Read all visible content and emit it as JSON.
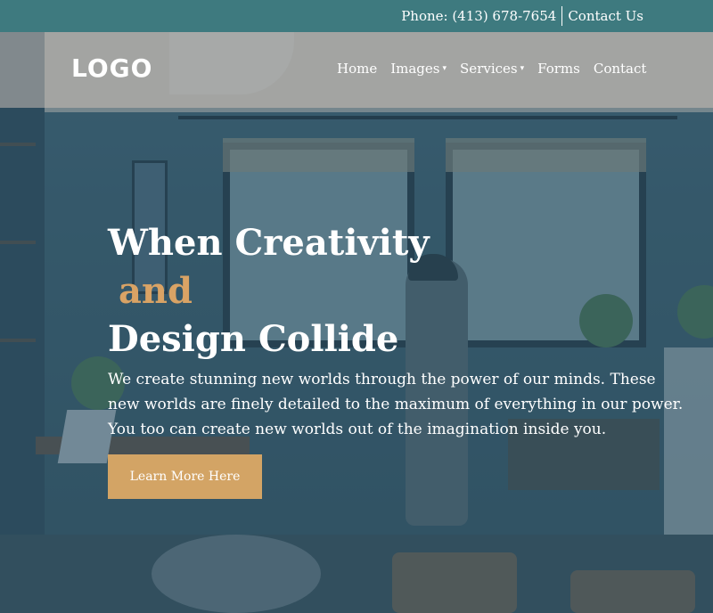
{
  "topbar": {
    "phone": "Phone: (413) 678-7654",
    "contact": "Contact Us"
  },
  "header": {
    "logo": "LOGO"
  },
  "nav": {
    "items": [
      {
        "label": "Home",
        "dropdown": false
      },
      {
        "label": "Images",
        "dropdown": true
      },
      {
        "label": "Services",
        "dropdown": true
      },
      {
        "label": "Forms",
        "dropdown": false
      },
      {
        "label": "Contact",
        "dropdown": false
      }
    ],
    "caret": "▾"
  },
  "hero": {
    "title_line1": "When Creativity",
    "title_line2": "and",
    "title_line3": "Design Collide",
    "text_line1": "We create stunning new worlds through the power of our minds. These",
    "text_line2": "new worlds are finely detailed to the maximum of everything in our power.",
    "text_line3": "You too can create new worlds out of the imagination inside you.",
    "cta_label": "Learn More Here"
  },
  "colors": {
    "topbar": "#3e7a7f",
    "accent": "#d3a465",
    "overlay": "#2c5268"
  }
}
